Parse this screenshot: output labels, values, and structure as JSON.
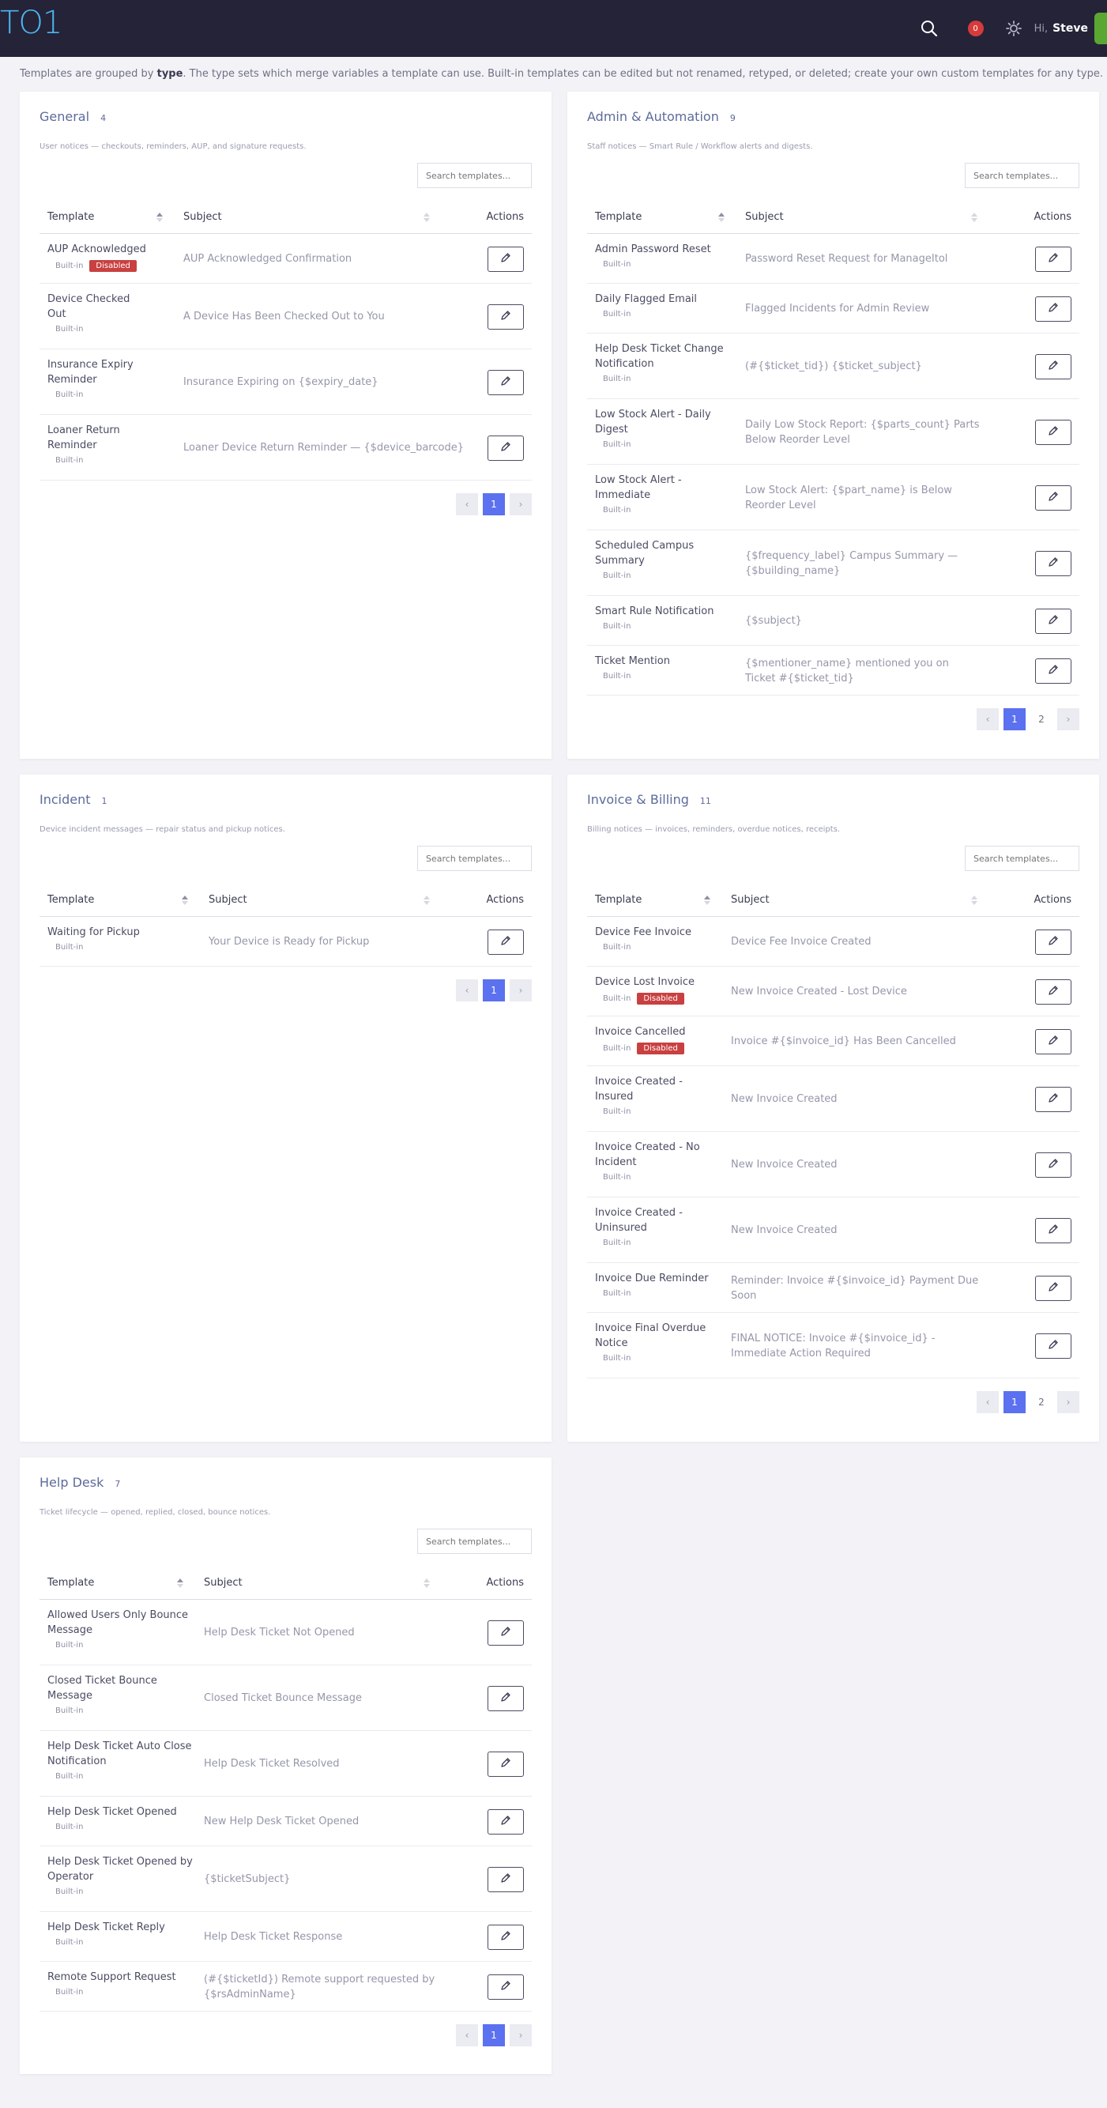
{
  "header": {
    "logo": "TO1",
    "notif_count": "0",
    "greeting": "Hi,",
    "user_name": "Steve"
  },
  "intro": {
    "before": "Templates are grouped by ",
    "bold": "type",
    "after": ". The type sets which merge variables a template can use. Built-in templates can be edited but not renamed, retyped, or deleted; create your own custom templates for any type."
  },
  "labels": {
    "search_placeholder": "Search templates...",
    "col_template": "Template",
    "col_subject": "Subject",
    "col_actions": "Actions",
    "builtin": "Built-in",
    "disabled": "Disabled",
    "prev": "‹",
    "next": "›"
  },
  "cards": [
    {
      "title": "General",
      "count": "4",
      "desc": "User notices — checkouts, reminders, AUP, and signature requests.",
      "rows": [
        {
          "name": [
            "AUP Acknowledged"
          ],
          "disabled": true,
          "subject": [
            "AUP Acknowledged Confirmation"
          ]
        },
        {
          "name": [
            "Device Checked",
            "Out"
          ],
          "disabled": false,
          "subject": [
            "A Device Has Been Checked Out to You"
          ]
        },
        {
          "name": [
            "Insurance Expiry",
            "Reminder"
          ],
          "disabled": false,
          "subject": [
            "Insurance Expiring on {$expiry_date}"
          ]
        },
        {
          "name": [
            "Loaner Return",
            "Reminder"
          ],
          "disabled": false,
          "subject": [
            "Loaner Device Return Reminder — {$device_barcode}"
          ]
        }
      ],
      "pages": [
        "1"
      ]
    },
    {
      "title": "Admin & Automation",
      "count": "9",
      "desc": "Staff notices — Smart Rule / Workflow alerts and digests.",
      "rows": [
        {
          "name": [
            "Admin Password Reset"
          ],
          "disabled": false,
          "subject": [
            "Password Reset Request for ManageItol"
          ]
        },
        {
          "name": [
            "Daily Flagged Email"
          ],
          "disabled": false,
          "subject": [
            "Flagged Incidents for Admin Review"
          ]
        },
        {
          "name": [
            "Help Desk Ticket Change",
            "Notification"
          ],
          "disabled": false,
          "subject": [
            "(#{$ticket_tid}) {$ticket_subject}"
          ]
        },
        {
          "name": [
            "Low Stock Alert - Daily",
            "Digest"
          ],
          "disabled": false,
          "subject": [
            "Daily Low Stock Report: {$parts_count} Parts",
            "Below Reorder Level"
          ]
        },
        {
          "name": [
            "Low Stock Alert -",
            "Immediate"
          ],
          "disabled": false,
          "subject": [
            "Low Stock Alert: {$part_name} is Below",
            "Reorder Level"
          ]
        },
        {
          "name": [
            "Scheduled Campus",
            "Summary"
          ],
          "disabled": false,
          "subject": [
            "{$frequency_label} Campus Summary —",
            "{$building_name}"
          ]
        },
        {
          "name": [
            "Smart Rule Notification"
          ],
          "disabled": false,
          "subject": [
            "{$subject}"
          ]
        },
        {
          "name": [
            "Ticket Mention"
          ],
          "disabled": false,
          "subject": [
            "{$mentioner_name} mentioned you on",
            "Ticket #{$ticket_tid}"
          ]
        }
      ],
      "pages": [
        "1",
        "2"
      ]
    },
    {
      "title": "Incident",
      "count": "1",
      "desc": "Device incident messages — repair status and pickup notices.",
      "rows": [
        {
          "name": [
            "Waiting for Pickup"
          ],
          "disabled": false,
          "subject": [
            "Your Device is Ready for Pickup"
          ]
        }
      ],
      "pages": [
        "1"
      ]
    },
    {
      "title": "Invoice & Billing",
      "count": "11",
      "desc": "Billing notices — invoices, reminders, overdue notices, receipts.",
      "rows": [
        {
          "name": [
            "Device Fee Invoice"
          ],
          "disabled": false,
          "subject": [
            "Device Fee Invoice Created"
          ]
        },
        {
          "name": [
            "Device Lost Invoice"
          ],
          "disabled": true,
          "subject": [
            "New Invoice Created - Lost Device"
          ]
        },
        {
          "name": [
            "Invoice Cancelled"
          ],
          "disabled": true,
          "subject": [
            "Invoice #{$invoice_id} Has Been Cancelled"
          ]
        },
        {
          "name": [
            "Invoice Created -",
            "Insured"
          ],
          "disabled": false,
          "subject": [
            "New Invoice Created"
          ]
        },
        {
          "name": [
            "Invoice Created - No",
            "Incident"
          ],
          "disabled": false,
          "subject": [
            "New Invoice Created"
          ]
        },
        {
          "name": [
            "Invoice Created -",
            "Uninsured"
          ],
          "disabled": false,
          "subject": [
            "New Invoice Created"
          ]
        },
        {
          "name": [
            "Invoice Due Reminder"
          ],
          "disabled": false,
          "subject": [
            "Reminder: Invoice #{$invoice_id} Payment Due",
            "Soon"
          ]
        },
        {
          "name": [
            "Invoice Final Overdue",
            "Notice"
          ],
          "disabled": false,
          "subject": [
            "FINAL NOTICE: Invoice #{$invoice_id} -",
            "Immediate Action Required"
          ]
        }
      ],
      "pages": [
        "1",
        "2"
      ]
    },
    {
      "title": "Help Desk",
      "count": "7",
      "desc": "Ticket lifecycle — opened, replied, closed, bounce notices.",
      "rows": [
        {
          "name": [
            "Allowed Users Only Bounce",
            "Message"
          ],
          "disabled": false,
          "subject": [
            "Help Desk Ticket Not Opened"
          ]
        },
        {
          "name": [
            "Closed Ticket Bounce",
            "Message"
          ],
          "disabled": false,
          "subject": [
            "Closed Ticket Bounce Message"
          ]
        },
        {
          "name": [
            "Help Desk Ticket Auto Close",
            "Notification"
          ],
          "disabled": false,
          "subject": [
            "Help Desk Ticket Resolved"
          ]
        },
        {
          "name": [
            "Help Desk Ticket Opened"
          ],
          "disabled": false,
          "subject": [
            "New Help Desk Ticket Opened"
          ]
        },
        {
          "name": [
            "Help Desk Ticket Opened by",
            "Operator"
          ],
          "disabled": false,
          "subject": [
            "{$ticketSubject}"
          ]
        },
        {
          "name": [
            "Help Desk Ticket Reply"
          ],
          "disabled": false,
          "subject": [
            "Help Desk Ticket Response"
          ]
        },
        {
          "name": [
            "Remote Support Request"
          ],
          "disabled": false,
          "subject": [
            "(#{$ticketId}) Remote support requested by",
            "{$rsAdminName}"
          ]
        }
      ],
      "pages": [
        "1"
      ]
    }
  ]
}
